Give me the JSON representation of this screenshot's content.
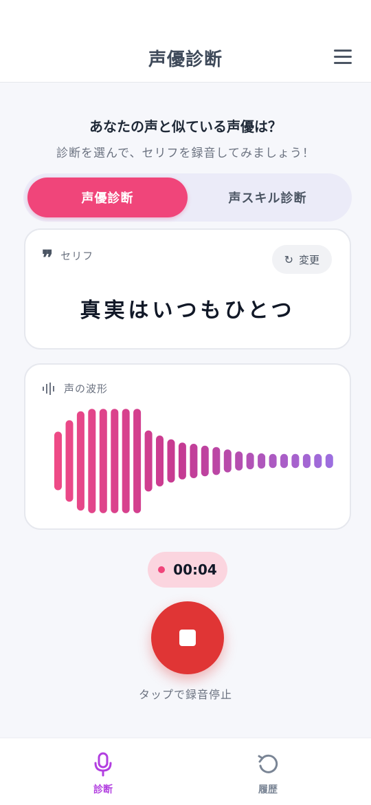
{
  "header": {
    "title": "声優診断",
    "menu_icon": "hamburger-menu-icon"
  },
  "intro": {
    "headline": "あなたの声と似ている声優は？",
    "subline": "診断を選んで、セリフを録音してみましょう！"
  },
  "segment": {
    "active_label": "声優診断",
    "inactive_label": "声スキル診断"
  },
  "line_card": {
    "label": "セリフ",
    "change_label": "変更",
    "quote": "真実はいつもひとつ"
  },
  "wave_card": {
    "label": "声の波形",
    "levels": [
      0.46,
      0.64,
      0.78,
      0.82,
      0.82,
      0.82,
      0.82,
      0.82,
      0.48,
      0.4,
      0.34,
      0.29,
      0.27,
      0.24,
      0.22,
      0.18,
      0.15,
      0.13,
      0.12,
      0.11,
      0.11,
      0.11,
      0.11,
      0.11,
      0.11
    ],
    "gradient_start": "#ef4a86",
    "gradient_mid": "#c53a92",
    "gradient_end": "#9c6fe0"
  },
  "recording": {
    "timer": "00:04",
    "hint": "タップで録音停止"
  },
  "tabbar": {
    "items": [
      {
        "label": "診断",
        "icon": "microphone-icon"
      },
      {
        "label": "履歴",
        "icon": "history-icon"
      }
    ]
  },
  "colors": {
    "accent_pink": "#f0457a",
    "record_red": "#e03535",
    "tab_active": "#b23fe0"
  }
}
